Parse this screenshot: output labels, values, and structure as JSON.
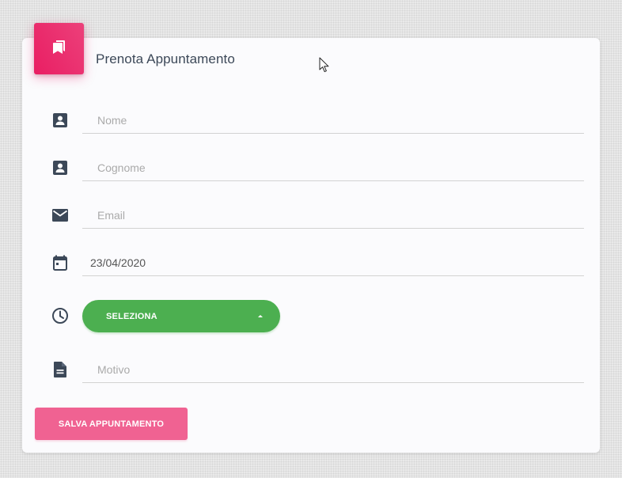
{
  "header": {
    "title": "Prenota Appuntamento",
    "icon": "bookmarks-icon",
    "accent_color": "#e91e63"
  },
  "form": {
    "nome": {
      "placeholder": "Nome",
      "value": "",
      "icon": "contact-card-icon"
    },
    "cognome": {
      "placeholder": "Cognome",
      "value": "",
      "icon": "contact-card-icon"
    },
    "email": {
      "placeholder": "Email",
      "value": "",
      "icon": "mail-icon"
    },
    "data": {
      "placeholder": "",
      "value": "23/04/2020",
      "icon": "calendar-icon"
    },
    "orario": {
      "label": "SELEZIONA",
      "icon": "clock-icon",
      "color": "#4caf50"
    },
    "motivo": {
      "placeholder": "Motivo",
      "value": "",
      "icon": "document-icon"
    }
  },
  "actions": {
    "save_label": "SALVA APPUNTAMENTO",
    "save_color": "#f06292"
  }
}
